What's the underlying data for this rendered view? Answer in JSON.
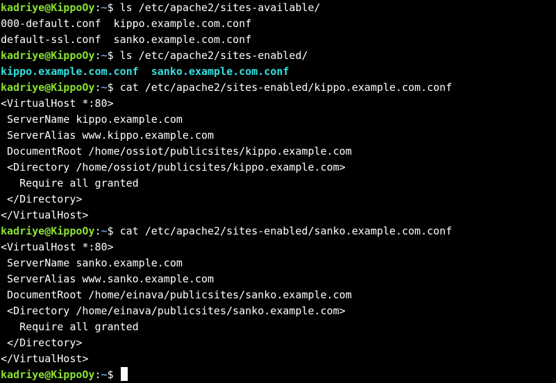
{
  "prompt": {
    "user_host": "kadriye@KippoOy",
    "sep": ":",
    "path": "~",
    "symbol": "$"
  },
  "commands": {
    "c1": "ls /etc/apache2/sites-available/",
    "c2": "ls /etc/apache2/sites-enabled/",
    "c3": "cat /etc/apache2/sites-enabled/kippo.example.com.conf",
    "c4": "cat /etc/apache2/sites-enabled/sanko.example.com.conf"
  },
  "sites_available": {
    "row1": "000-default.conf  kippo.example.com.conf",
    "row2": "default-ssl.conf  sanko.example.com.conf"
  },
  "sites_enabled": {
    "a": "kippo.example.com.conf",
    "b": "sanko.example.com.conf"
  },
  "kippo_conf": [
    "<VirtualHost *:80>",
    " ServerName kippo.example.com",
    " ServerAlias www.kippo.example.com",
    " DocumentRoot /home/ossiot/publicsites/kippo.example.com",
    " <Directory /home/ossiot/publicsites/kippo.example.com>",
    "   Require all granted",
    " </Directory>",
    "</VirtualHost>"
  ],
  "sanko_conf": [
    "<VirtualHost *:80>",
    " ServerName sanko.example.com",
    " ServerAlias www.sanko.example.com",
    " DocumentRoot /home/einava/publicsites/sanko.example.com",
    " <Directory /home/einava/publicsites/sanko.example.com>",
    "   Require all granted",
    " </Directory>",
    "</VirtualHost>"
  ]
}
